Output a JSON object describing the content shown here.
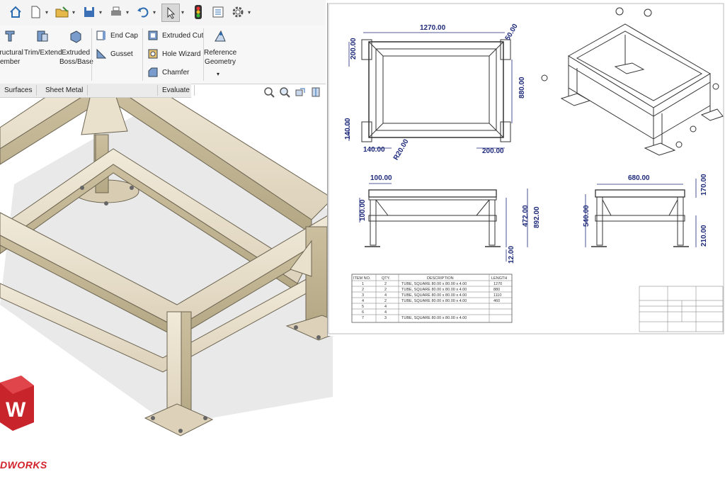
{
  "toolbar": {
    "icons": [
      "home-icon",
      "new-document-icon",
      "open-file-icon",
      "save-icon",
      "print-icon",
      "undo-icon",
      "select-pointer-icon",
      "traffic-light-icon",
      "list-icon",
      "gear-icon"
    ]
  },
  "ribbon": {
    "structural_member": "Structural\nMember",
    "trim_extend": "Trim/Extend",
    "extruded_boss": "Extruded\nBoss/Base",
    "end_cap": "End Cap",
    "gusset": "Gusset",
    "extruded_cut": "Extruded Cut",
    "hole_wizard": "Hole Wizard",
    "chamfer": "Chamfer",
    "reference_geometry": "Reference\nGeometry"
  },
  "tabs": [
    "Surfaces",
    "Sheet Metal",
    "Evaluate"
  ],
  "view_icons": [
    "zoom-to-fit-icon",
    "zoom-area-icon",
    "rotate-view-icon",
    "section-view-icon"
  ],
  "drawing": {
    "top_view": {
      "width": "1270.00",
      "left_top": "200.00",
      "left_bottom": "140.00",
      "right_height": "880.00",
      "bottom_left": "140.00",
      "bottom_right": "200.00",
      "radius": "R20.00",
      "corner": "50.00"
    },
    "front_view": {
      "top": "100.00",
      "left_h": "100.00",
      "mid": "472.00",
      "overall": "892.00",
      "foot": "12.00"
    },
    "side_view": {
      "width": "680.00",
      "right_top": "170.00",
      "left": "540.00",
      "right_bottom": "210.00"
    },
    "bom": {
      "headers": [
        "ITEM NO.",
        "QTY.",
        "DESCRIPTION",
        "LENGTH"
      ],
      "rows": [
        [
          "1",
          "2",
          "TUBE, SQUARE 80.00 x 80.00 x 4.00",
          "1270"
        ],
        [
          "2",
          "2",
          "TUBE, SQUARE 80.00 x 80.00 x 4.00",
          "880"
        ],
        [
          "3",
          "4",
          "TUBE, SQUARE 80.00 x 80.00 x 4.00",
          "1110"
        ],
        [
          "4",
          "2",
          "TUBE, SQUARE 80.00 x 80.00 x 4.00",
          "460"
        ],
        [
          "5",
          "4",
          "",
          ""
        ],
        [
          "6",
          "4",
          "",
          ""
        ],
        [
          "7",
          "3",
          "TUBE, SQUARE 80.00 x 80.00 x 4.00",
          ""
        ]
      ]
    }
  },
  "brand": {
    "text": "DWORKS",
    "color": "#d2232a"
  }
}
